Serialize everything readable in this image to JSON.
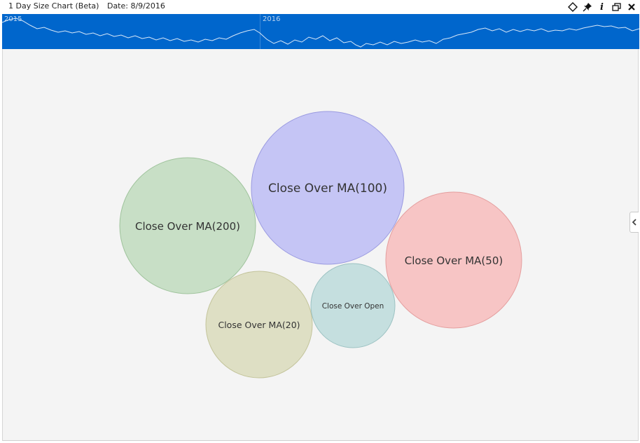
{
  "header": {
    "title": "1 Day Size Chart (Beta)",
    "date": "Date: 8/9/2016"
  },
  "toolbar": {
    "icons": [
      "diamond-icon",
      "pin-icon",
      "info-icon",
      "popout-icon",
      "close-icon"
    ],
    "info_glyph": "i"
  },
  "navigator": {
    "years": [
      "2015",
      "2016"
    ],
    "background": "#0066cc"
  },
  "side_panel": {
    "toggle_icon": "chevron-left-icon"
  },
  "bubbles": [
    {
      "label": "Close Over MA(100)",
      "fill": "#c5c5f5",
      "stroke": "#9a9ae0"
    },
    {
      "label": "Close Over MA(200)",
      "fill": "#c8dfc6",
      "stroke": "#9fc39c"
    },
    {
      "label": "Close Over MA(50)",
      "fill": "#f7c5c5",
      "stroke": "#e49e9e"
    },
    {
      "label": "Close Over MA(20)",
      "fill": "#dedfc4",
      "stroke": "#c3c49b"
    },
    {
      "label": "Close Over Open",
      "fill": "#c5dfdf",
      "stroke": "#9cc2c2"
    }
  ]
}
